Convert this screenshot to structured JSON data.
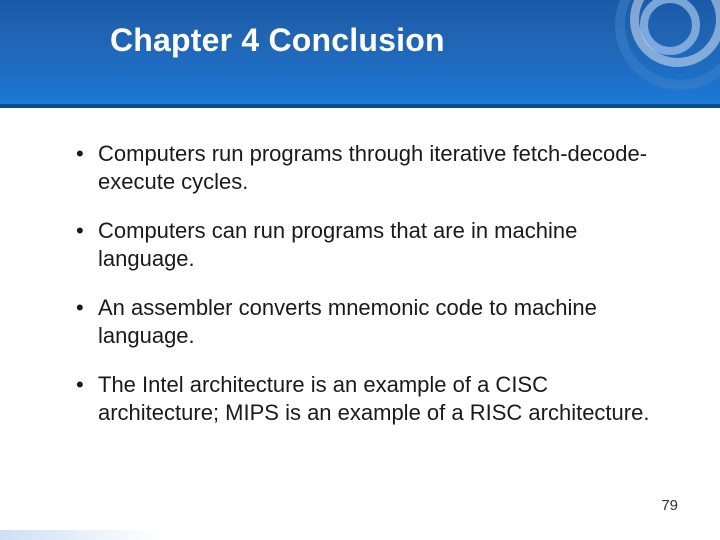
{
  "header": {
    "title": "Chapter 4 Conclusion"
  },
  "bullets": [
    "Computers run programs through iterative fetch-decode-execute cycles.",
    "Computers can run programs that are in machine language.",
    "An assembler converts mnemonic code to machine language.",
    "The Intel architecture is an example of a CISC architecture; MIPS is an example of a RISC architecture."
  ],
  "page_number": "79"
}
